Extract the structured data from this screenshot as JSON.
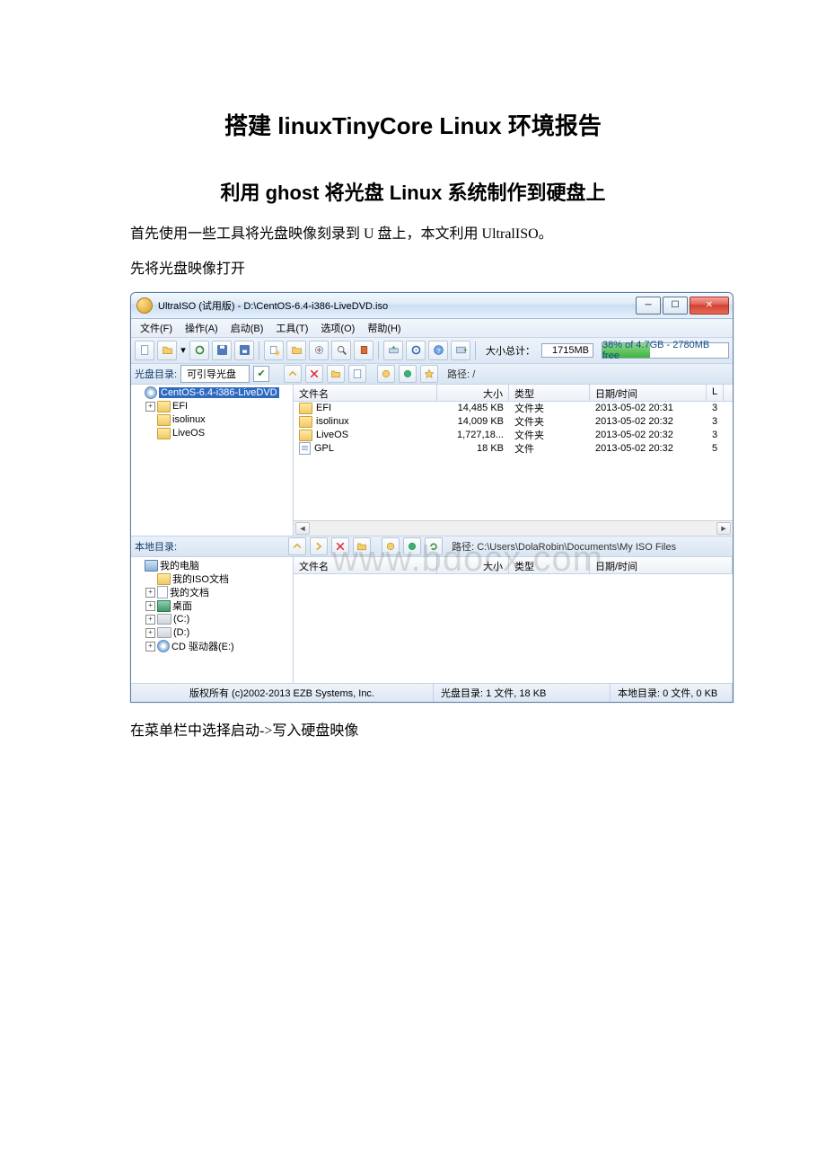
{
  "doc": {
    "title": "搭建 linuxTinyCore Linux 环境报告",
    "subtitle": "利用 ghost 将光盘 Linux 系统制作到硬盘上",
    "p1": "首先使用一些工具将光盘映像刻录到 U 盘上，本文利用 UltralISO。",
    "p2": "先将光盘映像打开",
    "p3": "在菜单栏中选择启动->写入硬盘映像"
  },
  "win": {
    "title": "UltraISO (试用版) - D:\\CentOS-6.4-i386-LiveDVD.iso",
    "menus": [
      "文件(F)",
      "操作(A)",
      "启动(B)",
      "工具(T)",
      "选项(O)",
      "帮助(H)"
    ],
    "sizeLabel": "大小总计：",
    "sizeValue": "1715MB",
    "freeText": "38% of 4.7GB - 2780MB free",
    "topPane": {
      "label": "光盘目录:",
      "combo": "可引导光盘",
      "pathLabel": "路径:",
      "pathValue": "/"
    },
    "tree": {
      "root": "CentOS-6.4-i386-LiveDVD",
      "children": [
        "EFI",
        "isolinux",
        "LiveOS"
      ]
    },
    "list": {
      "headers": {
        "name": "文件名",
        "size": "大小",
        "type": "类型",
        "date": "日期/时间",
        "x": "L"
      },
      "rows": [
        {
          "name": "EFI",
          "kind": "folder",
          "size": "14,485 KB",
          "type": "文件夹",
          "date": "2013-05-02 20:31",
          "x": "3"
        },
        {
          "name": "isolinux",
          "kind": "folder",
          "size": "14,009 KB",
          "type": "文件夹",
          "date": "2013-05-02 20:32",
          "x": "3"
        },
        {
          "name": "LiveOS",
          "kind": "folder",
          "size": "1,727,18...",
          "type": "文件夹",
          "date": "2013-05-02 20:32",
          "x": "3"
        },
        {
          "name": "GPL",
          "kind": "file",
          "size": "18 KB",
          "type": "文件",
          "date": "2013-05-02 20:32",
          "x": "5"
        }
      ]
    },
    "bottomPane": {
      "label": "本地目录:",
      "pathLabel": "路径:",
      "pathValue": "C:\\Users\\DolaRobin\\Documents\\My ISO Files"
    },
    "localTree": {
      "root": "我的电脑",
      "children": [
        "我的ISO文档",
        "我的文档",
        "桌面",
        "(C:)",
        "(D:)",
        "CD 驱动器(E:)"
      ]
    },
    "localList": {
      "headers": {
        "name": "文件名",
        "size": "大小",
        "type": "类型",
        "date": "日期/时间"
      }
    },
    "status": {
      "copyright": "版权所有 (c)2002-2013 EZB Systems, Inc.",
      "cd": "光盘目录: 1 文件, 18 KB",
      "local": "本地目录: 0 文件, 0 KB"
    },
    "watermark": "www.bdocx.com"
  }
}
